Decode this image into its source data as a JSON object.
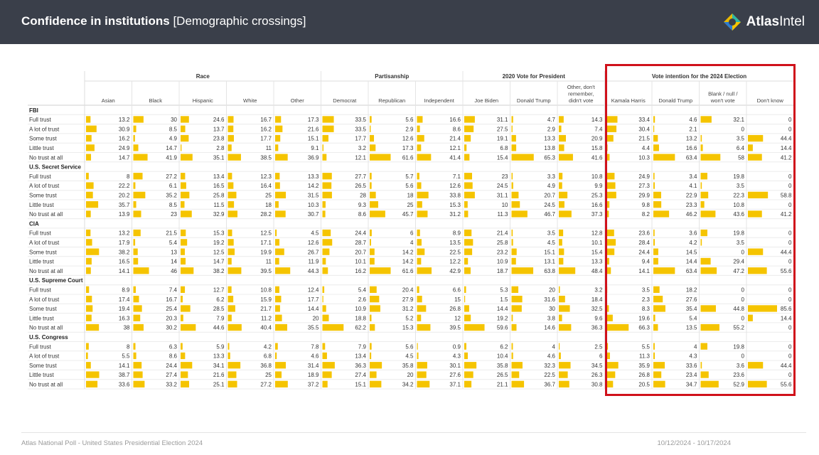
{
  "header": {
    "title_bold": "Confidence in institutions",
    "title_rest": " [Demographic crossings]",
    "logo_bold": "Atlas",
    "logo_rest": "Intel"
  },
  "footer": {
    "source": "Atlas National Poll - United States Presidential Election 2024",
    "dates": "10/12/2024 - 10/17/2024"
  },
  "colors": {
    "bar": "#f5c400",
    "header_bg": "#3a3f4a",
    "highlight": "#d0111b"
  },
  "chart_data": {
    "type": "table",
    "title": "Confidence in institutions",
    "groups": [
      {
        "label": "Race",
        "span": 5
      },
      {
        "label": "Partisanship",
        "span": 3
      },
      {
        "label": "2020 Vote for President",
        "span": 3
      },
      {
        "label": "Vote intention for the 2024 Election",
        "span": 4
      }
    ],
    "columns": [
      "Asian",
      "Black",
      "Hispanic",
      "White",
      "Other",
      "Democrat",
      "Republican",
      "Independent",
      "Joe Biden",
      "Donald Trump",
      "Other, don't|remember,|didn't vote",
      "Kamala Harris",
      "Donald Trump",
      "Blank / null /|won't vote",
      "Don't know"
    ],
    "sections": [
      {
        "name": "FBI",
        "rows": [
          {
            "label": "Full trust",
            "values": [
              13.2,
              30,
              24.6,
              16.7,
              17.3,
              33.5,
              5.6,
              16.6,
              31.1,
              4.7,
              14.3,
              33.4,
              4.6,
              32.1,
              0
            ]
          },
          {
            "label": "A lot of trust",
            "values": [
              30.9,
              8.5,
              13.7,
              16.2,
              21.6,
              33.5,
              2.9,
              8.6,
              27.5,
              2.9,
              7.4,
              30.4,
              2.1,
              0,
              0
            ]
          },
          {
            "label": "Some trust",
            "values": [
              16.2,
              4.9,
              23.8,
              17.7,
              15.1,
              17.7,
              12.6,
              21.4,
              19.1,
              13.3,
              20.9,
              21.5,
              13.2,
              3.5,
              44.4
            ]
          },
          {
            "label": "Little trust",
            "values": [
              24.9,
              14.7,
              2.8,
              11,
              9.1,
              3.2,
              17.3,
              12.1,
              6.8,
              13.8,
              15.8,
              4.4,
              16.6,
              6.4,
              14.4
            ]
          },
          {
            "label": "No trust at all",
            "values": [
              14.7,
              41.9,
              35.1,
              38.5,
              36.9,
              12.1,
              61.6,
              41.4,
              15.4,
              65.3,
              41.6,
              10.3,
              63.4,
              58,
              41.2
            ]
          }
        ]
      },
      {
        "name": "U.S. Secret Service",
        "rows": [
          {
            "label": "Full trust",
            "values": [
              8,
              27.2,
              13.4,
              12.3,
              13.3,
              27.7,
              5.7,
              7.1,
              23,
              3.3,
              10.8,
              24.9,
              3.4,
              19.8,
              0
            ]
          },
          {
            "label": "A lot of trust",
            "values": [
              22.2,
              6.1,
              16.5,
              16.4,
              14.2,
              26.5,
              5.6,
              12.6,
              24.5,
              4.9,
              9.9,
              27.3,
              4.1,
              3.5,
              0
            ]
          },
          {
            "label": "Some trust",
            "values": [
              20.2,
              35.2,
              25.8,
              25,
              31.5,
              28,
              18,
              33.8,
              31.1,
              20.7,
              25.3,
              29.9,
              22.9,
              22.3,
              58.8
            ]
          },
          {
            "label": "Little trust",
            "values": [
              35.7,
              8.5,
              11.5,
              18,
              10.3,
              9.3,
              25,
              15.3,
              10,
              24.5,
              16.6,
              9.8,
              23.3,
              10.8,
              0
            ]
          },
          {
            "label": "No trust at all",
            "values": [
              13.9,
              23,
              32.9,
              28.2,
              30.7,
              8.6,
              45.7,
              31.2,
              11.3,
              46.7,
              37.3,
              8.2,
              46.2,
              43.6,
              41.2
            ]
          }
        ]
      },
      {
        "name": "CIA",
        "rows": [
          {
            "label": "Full trust",
            "values": [
              13.2,
              21.5,
              15.3,
              12.5,
              4.5,
              24.4,
              6,
              8.9,
              21.4,
              3.5,
              12.8,
              23.6,
              3.6,
              19.8,
              0
            ]
          },
          {
            "label": "A lot of trust",
            "values": [
              17.9,
              5.4,
              19.2,
              17.1,
              12.6,
              28.7,
              4,
              13.5,
              25.8,
              4.5,
              10.1,
              28.4,
              4.2,
              3.5,
              0
            ]
          },
          {
            "label": "Some trust",
            "values": [
              38.2,
              13,
              12.5,
              19.9,
              26.7,
              20.7,
              14.2,
              22.5,
              23.2,
              15.1,
              15.4,
              24.4,
              14.5,
              0,
              44.4
            ]
          },
          {
            "label": "Little trust",
            "values": [
              16.5,
              14,
              14.7,
              11,
              11.9,
              10.1,
              14.2,
              12.2,
              10.9,
              13.1,
              13.3,
              9.4,
              14.4,
              29.4,
              0
            ]
          },
          {
            "label": "No trust at all",
            "values": [
              14.1,
              46,
              38.2,
              39.5,
              44.3,
              16.2,
              61.6,
              42.9,
              18.7,
              63.8,
              48.4,
              14.1,
              63.4,
              47.2,
              55.6
            ]
          }
        ]
      },
      {
        "name": "U.S. Supreme Court",
        "rows": [
          {
            "label": "Full trust",
            "values": [
              8.9,
              7.4,
              12.7,
              10.8,
              12.4,
              5.4,
              20.4,
              6.6,
              5.3,
              20,
              3.2,
              3.5,
              18.2,
              0,
              0
            ]
          },
          {
            "label": "A lot of trust",
            "values": [
              17.4,
              16.7,
              6.2,
              15.9,
              17.7,
              2.6,
              27.9,
              15,
              1.5,
              31.6,
              18.4,
              2.3,
              27.6,
              0,
              0
            ]
          },
          {
            "label": "Some trust",
            "values": [
              19.4,
              25.4,
              28.5,
              21.7,
              14.4,
              10.9,
              31.2,
              26.8,
              14.4,
              30,
              32.5,
              8.3,
              35.4,
              44.8,
              85.6
            ]
          },
          {
            "label": "Little trust",
            "values": [
              16.3,
              20.3,
              7.9,
              11.2,
              20,
              18.8,
              5.2,
              12,
              19.2,
              3.8,
              9.6,
              19.6,
              5.4,
              0,
              14.4
            ]
          },
          {
            "label": "No trust at all",
            "values": [
              38,
              30.2,
              44.6,
              40.4,
              35.5,
              62.2,
              15.3,
              39.5,
              59.6,
              14.6,
              36.3,
              66.3,
              13.5,
              55.2,
              0
            ]
          }
        ]
      },
      {
        "name": "U.S. Congress",
        "rows": [
          {
            "label": "Full trust",
            "values": [
              8,
              6.3,
              5.9,
              4.2,
              7.8,
              7.9,
              5.6,
              0.9,
              6.2,
              4,
              2.5,
              5.5,
              4,
              19.8,
              0
            ]
          },
          {
            "label": "A lot of trust",
            "values": [
              5.5,
              8.6,
              13.3,
              6.8,
              4.6,
              13.4,
              4.5,
              4.3,
              10.4,
              4.6,
              6,
              11.3,
              4.3,
              0,
              0
            ]
          },
          {
            "label": "Some trust",
            "values": [
              14.1,
              24.4,
              34.1,
              36.8,
              31.4,
              36.3,
              35.8,
              30.1,
              35.8,
              32.3,
              34.5,
              35.9,
              33.6,
              3.6,
              44.4
            ]
          },
          {
            "label": "Little trust",
            "values": [
              38.7,
              27.4,
              21.6,
              25,
              18.9,
              27.4,
              20,
              27.6,
              26.5,
              22.5,
              26.3,
              26.8,
              23.4,
              23.6,
              0
            ]
          },
          {
            "label": "No trust at all",
            "values": [
              33.6,
              33.2,
              25.1,
              27.2,
              37.2,
              15.1,
              34.2,
              37.1,
              21.1,
              36.7,
              30.8,
              20.5,
              34.7,
              52.9,
              55.6
            ]
          }
        ]
      }
    ]
  }
}
